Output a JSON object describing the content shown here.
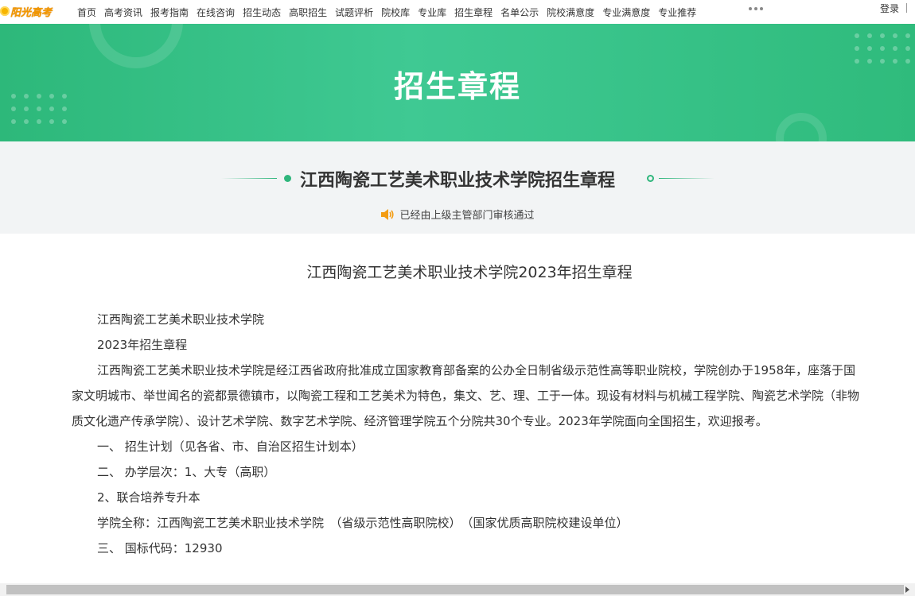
{
  "nav": {
    "logo": "阳光高考",
    "items": [
      "首页",
      "高考资讯",
      "报考指南",
      "在线咨询",
      "招生动态",
      "高职招生",
      "试题评析",
      "院校库",
      "专业库",
      "招生章程",
      "名单公示",
      "院校满意度",
      "专业满意度",
      "专业推荐"
    ],
    "login": "登录"
  },
  "banner": {
    "title": "招生章程"
  },
  "subhead": {
    "title": "江西陶瓷工艺美术职业技术学院招生章程",
    "verify_text": "已经由上级主管部门审核通过"
  },
  "article": {
    "title": "江西陶瓷工艺美术职业技术学院2023年招生章程",
    "paragraphs": [
      "江西陶瓷工艺美术职业技术学院",
      "2023年招生章程",
      "江西陶瓷工艺美术职业技术学院是经江西省政府批准成立国家教育部备案的公办全日制省级示范性高等职业院校，学院创办于1958年，座落于国家文明城市、举世闻名的瓷都景德镇市，以陶瓷工程和工艺美术为特色，集文、艺、理、工于一体。现设有材料与机械工程学院、陶瓷艺术学院（非物质文化遗产传承学院）、设计艺术学院、数字艺术学院、经济管理学院五个分院共30个专业。2023年学院面向全国招生，欢迎报考。",
      "一、 招生计划（见各省、市、自治区招生计划本）",
      "二、 办学层次：1、大专（高职）",
      "2、联合培养专升本",
      "学院全称：江西陶瓷工艺美术职业技术学院　（省级示范性高职院校）　（国家优质高职院校建设单位）",
      "三、 国标代码：12930"
    ]
  },
  "colors": {
    "accent": "#2fb67c",
    "banner": "#3fc993",
    "logo": "#f39800"
  }
}
